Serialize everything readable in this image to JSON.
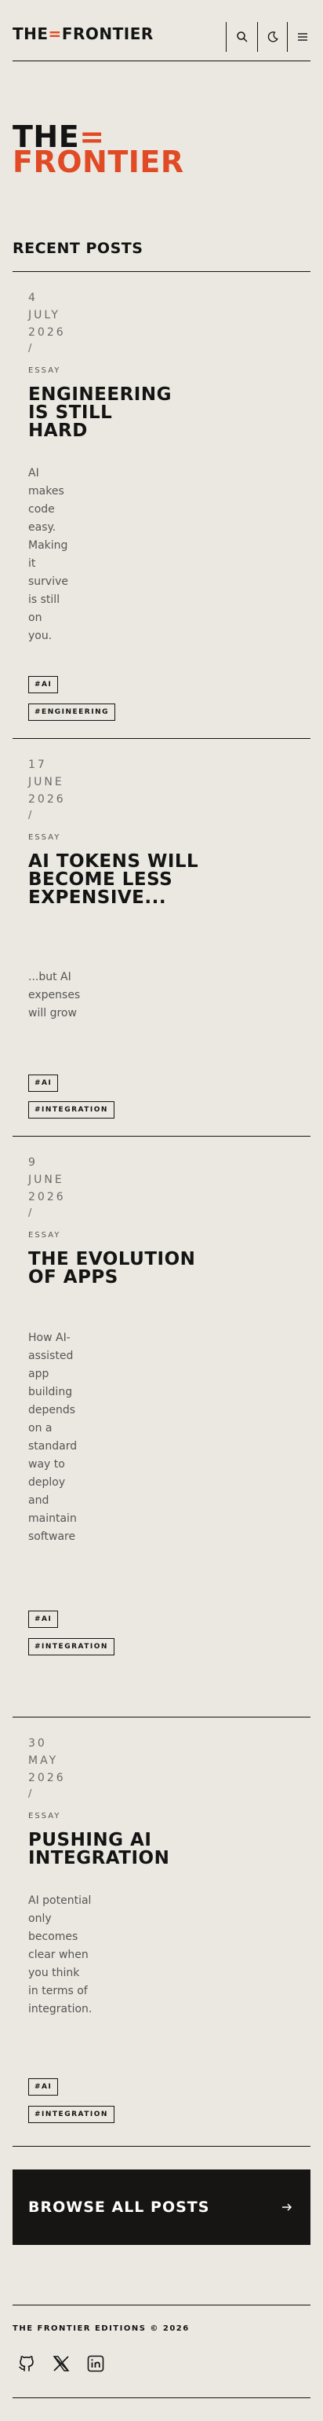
{
  "header": {
    "logo_part1": "THE",
    "logo_accent": "=",
    "logo_part2": "FRONTIER",
    "icons": [
      "search-icon",
      "moon-icon",
      "menu-icon"
    ]
  },
  "hero": {
    "line1": "THE",
    "accent": "=",
    "line2": "FRONTIER"
  },
  "section_title": "RECENT POSTS",
  "posts": [
    {
      "day": "4",
      "month": "JULY",
      "year": "2026",
      "separator": "/",
      "category": "ESSAY",
      "title": "ENGINEERING IS STILL HARD",
      "excerpt": "AI makes code easy. Making it survive is still on you.",
      "tags": [
        "#AI",
        "#ENGINEERING"
      ]
    },
    {
      "day": "17",
      "month": "JUNE",
      "year": "2026",
      "separator": "/",
      "category": "ESSAY",
      "title": "AI TOKENS WILL BECOME LESS EXPENSIVE...",
      "excerpt": "...but AI expenses will grow",
      "tags": [
        "#AI",
        "#INTEGRATION"
      ]
    },
    {
      "day": "9",
      "month": "JUNE",
      "year": "2026",
      "separator": "/",
      "category": "ESSAY",
      "title": "THE EVOLUTION OF APPS",
      "excerpt": "How AI-assisted app building depends on a standard way to deploy and maintain software",
      "tags": [
        "#AI",
        "#INTEGRATION"
      ]
    },
    {
      "day": "30",
      "month": "MAY",
      "year": "2026",
      "separator": "/",
      "category": "ESSAY",
      "title": "PUSHING AI INTEGRATION",
      "excerpt": "AI potential only becomes clear when you think in terms of integration.",
      "tags": [
        "#AI",
        "#INTEGRATION"
      ]
    }
  ],
  "browse_label": "BROWSE ALL POSTS",
  "footer": {
    "copyright": "THE FRONTIER EDITIONS © 2026",
    "social": [
      "github-icon",
      "x-icon",
      "linkedin-icon"
    ]
  },
  "colors": {
    "accent": "#e04a25",
    "background": "#ebe8e1",
    "ink": "#141414",
    "button": "#171513"
  }
}
